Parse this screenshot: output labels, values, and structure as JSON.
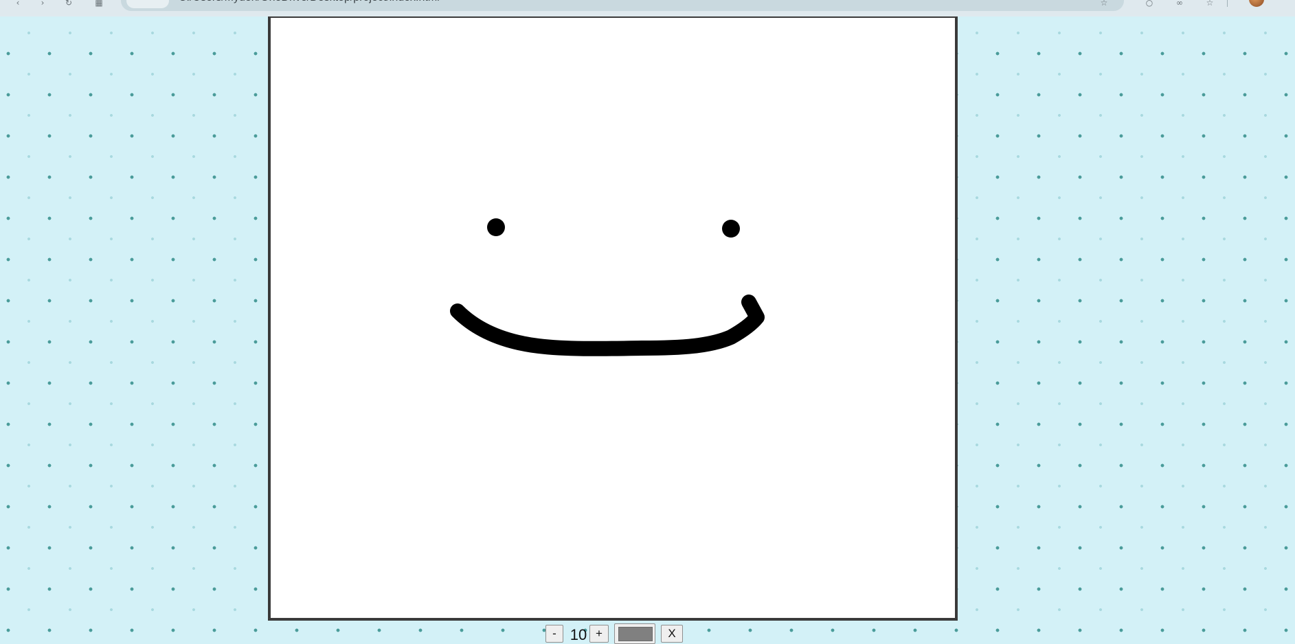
{
  "browser": {
    "url": "C:/Users/Myden/OneDrive/Desktop/project/index.html",
    "icons": [
      "back-icon",
      "forward-icon",
      "reload-icon",
      "tab-grid-icon",
      "site-info-icon",
      "bookmark-star-icon",
      "extension-icon",
      "profile-icon"
    ]
  },
  "canvas": {
    "background": "#ffffff",
    "stroke_color": "#000000",
    "drawing": "smiley-face"
  },
  "controls": {
    "decrease_label": "-",
    "brush_size": "10",
    "increase_label": "+",
    "color_value": "#808080",
    "clear_label": "X"
  },
  "colors": {
    "page_background": "#d3f1f7",
    "pattern_dot": "#4a9c9a",
    "canvas_border": "#3a3a3a"
  }
}
